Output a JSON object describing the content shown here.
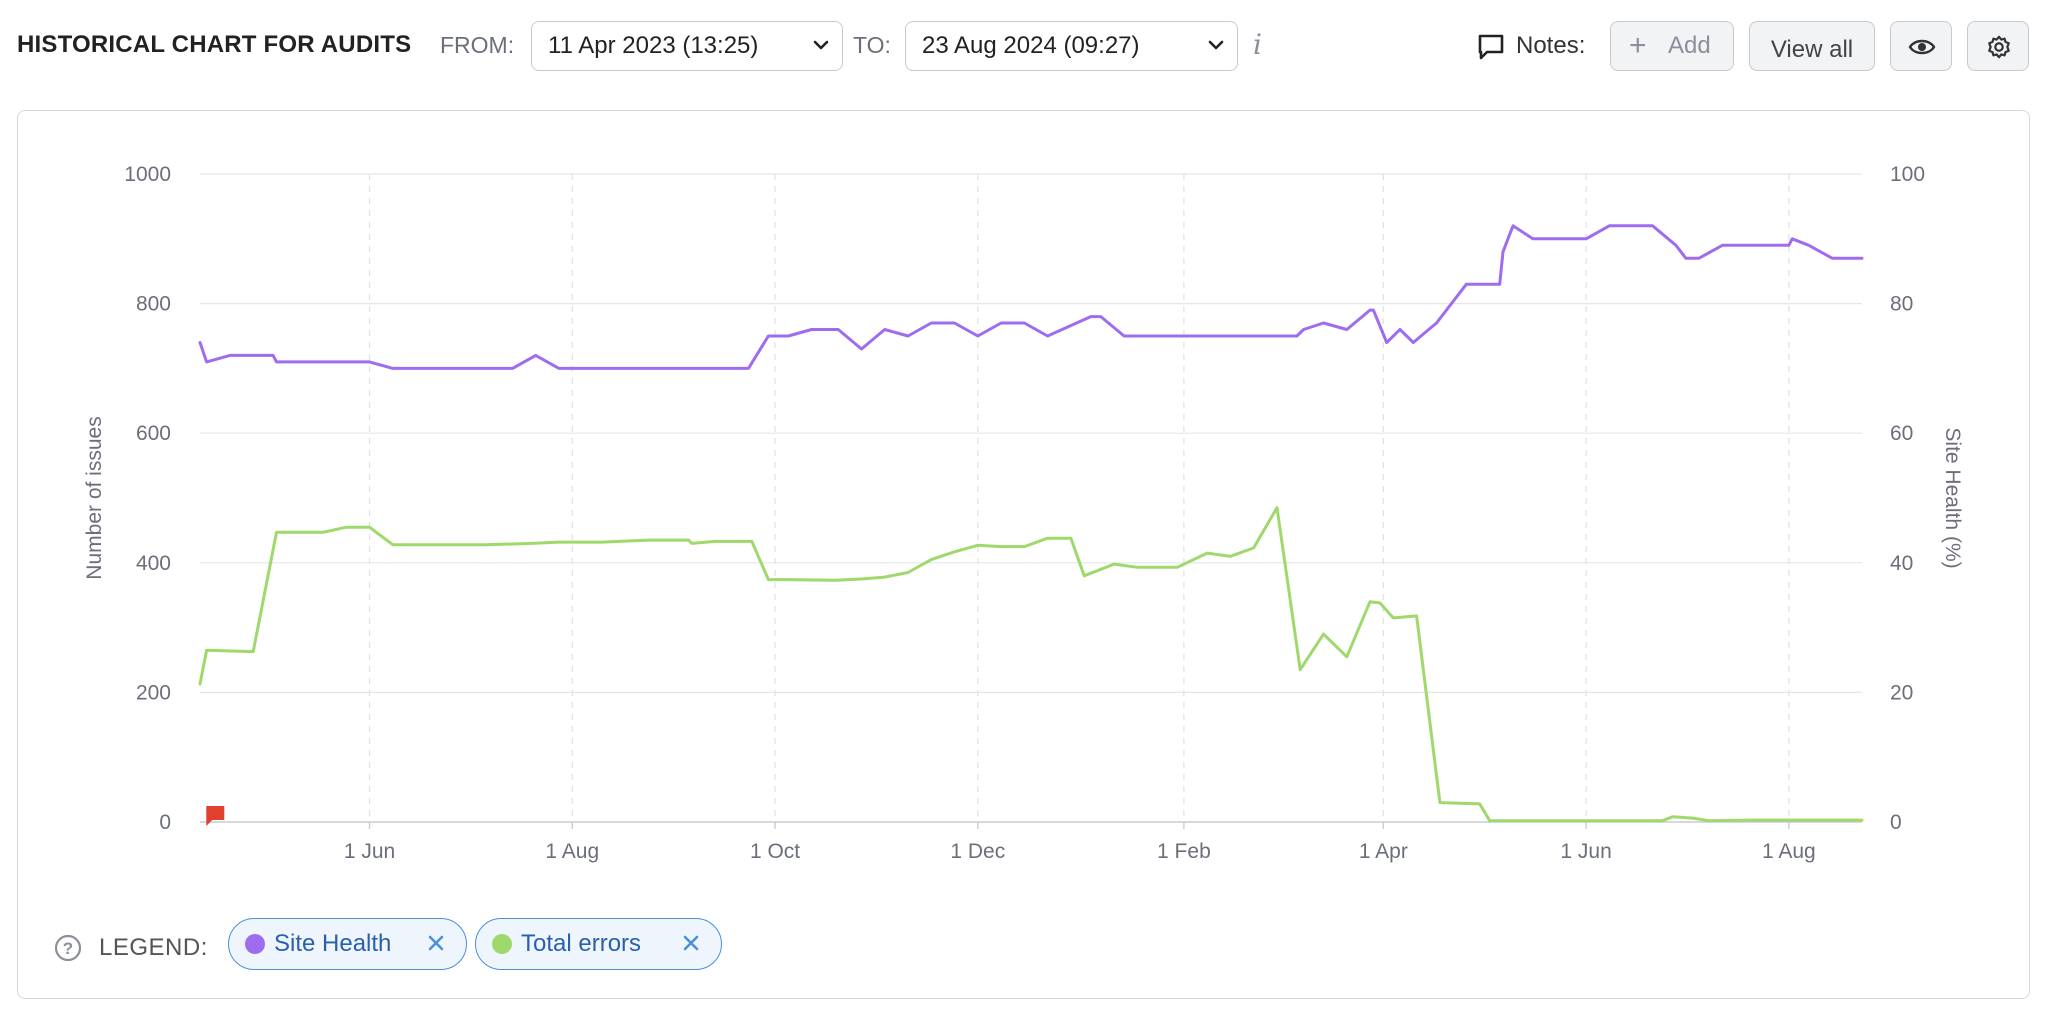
{
  "toolbar": {
    "title": "HISTORICAL CHART FOR AUDITS",
    "from_label": "FROM:",
    "from_value": "11 Apr 2023 (13:25)",
    "to_label": "TO:",
    "to_value": "23 Aug 2024 (09:27)",
    "info_glyph": "i",
    "notes_label": "Notes:",
    "add_label": "Add",
    "view_all_label": "View all",
    "icons": [
      "chevron-down-icon",
      "info-icon",
      "comment-icon",
      "plus-icon",
      "eye-icon",
      "gear-icon"
    ]
  },
  "legend": {
    "label": "LEGEND:",
    "items": [
      {
        "name": "Site Health",
        "color": "#9f6cf0"
      },
      {
        "name": "Total errors",
        "color": "#9fd86b"
      }
    ]
  },
  "chart_data": {
    "type": "line",
    "ylabel": "Number of issues",
    "y2label": "Site Health (%)",
    "ylim": [
      0,
      1000
    ],
    "y2lim": [
      0,
      100
    ],
    "yticks": [
      0,
      200,
      400,
      600,
      800,
      1000
    ],
    "y2ticks": [
      0,
      20,
      40,
      60,
      80,
      100
    ],
    "xlim": [
      "2023-04-11",
      "2024-08-23"
    ],
    "xticks": [
      {
        "date": "2023-06-01",
        "label": "1 Jun"
      },
      {
        "date": "2023-08-01",
        "label": "1 Aug"
      },
      {
        "date": "2023-10-01",
        "label": "1 Oct"
      },
      {
        "date": "2023-12-01",
        "label": "1 Dec"
      },
      {
        "date": "2024-02-01",
        "label": "1 Feb"
      },
      {
        "date": "2024-04-01",
        "label": "1 Apr"
      },
      {
        "date": "2024-06-01",
        "label": "1 Jun"
      },
      {
        "date": "2024-08-01",
        "label": "1 Aug"
      }
    ],
    "grid": true,
    "marker": {
      "date": "2023-04-15",
      "value": 0,
      "color": "#e0412e"
    },
    "series": [
      {
        "name": "Site Health",
        "axis": "right",
        "color": "#9f6cf0",
        "points": [
          [
            "2023-04-11",
            74
          ],
          [
            "2023-04-13",
            71
          ],
          [
            "2023-04-20",
            72
          ],
          [
            "2023-05-03",
            72
          ],
          [
            "2023-05-04",
            71
          ],
          [
            "2023-06-01",
            71
          ],
          [
            "2023-06-08",
            70
          ],
          [
            "2023-07-14",
            70
          ],
          [
            "2023-07-21",
            72
          ],
          [
            "2023-07-28",
            70
          ],
          [
            "2023-09-23",
            70
          ],
          [
            "2023-09-29",
            75
          ],
          [
            "2023-10-05",
            75
          ],
          [
            "2023-10-12",
            76
          ],
          [
            "2023-10-20",
            76
          ],
          [
            "2023-10-27",
            73
          ],
          [
            "2023-11-03",
            76
          ],
          [
            "2023-11-10",
            75
          ],
          [
            "2023-11-17",
            77
          ],
          [
            "2023-11-24",
            77
          ],
          [
            "2023-12-01",
            75
          ],
          [
            "2023-12-08",
            77
          ],
          [
            "2023-12-15",
            77
          ],
          [
            "2023-12-22",
            75
          ],
          [
            "2024-01-04",
            78
          ],
          [
            "2024-01-07",
            78
          ],
          [
            "2024-01-14",
            75
          ],
          [
            "2024-03-06",
            75
          ],
          [
            "2024-03-08",
            76
          ],
          [
            "2024-03-14",
            77
          ],
          [
            "2024-03-21",
            76
          ],
          [
            "2024-03-28",
            79
          ],
          [
            "2024-03-29",
            79
          ],
          [
            "2024-04-02",
            74
          ],
          [
            "2024-04-06",
            76
          ],
          [
            "2024-04-10",
            74
          ],
          [
            "2024-04-17",
            77
          ],
          [
            "2024-04-26",
            83
          ],
          [
            "2024-05-06",
            83
          ],
          [
            "2024-05-07",
            88
          ],
          [
            "2024-05-10",
            92
          ],
          [
            "2024-05-16",
            90
          ],
          [
            "2024-06-01",
            90
          ],
          [
            "2024-06-08",
            92
          ],
          [
            "2024-06-21",
            92
          ],
          [
            "2024-06-28",
            89
          ],
          [
            "2024-07-01",
            87
          ],
          [
            "2024-07-05",
            87
          ],
          [
            "2024-07-12",
            89
          ],
          [
            "2024-07-26",
            89
          ],
          [
            "2024-08-01",
            89
          ],
          [
            "2024-08-02",
            90
          ],
          [
            "2024-08-07",
            89
          ],
          [
            "2024-08-14",
            87
          ],
          [
            "2024-08-23",
            87
          ]
        ]
      },
      {
        "name": "Total errors",
        "axis": "left",
        "color": "#9fd86b",
        "points": [
          [
            "2023-04-11",
            213
          ],
          [
            "2023-04-13",
            265
          ],
          [
            "2023-04-27",
            263
          ],
          [
            "2023-05-04",
            447
          ],
          [
            "2023-05-18",
            447
          ],
          [
            "2023-05-25",
            455
          ],
          [
            "2023-06-01",
            455
          ],
          [
            "2023-06-08",
            428
          ],
          [
            "2023-06-22",
            428
          ],
          [
            "2023-07-06",
            428
          ],
          [
            "2023-07-20",
            430
          ],
          [
            "2023-07-28",
            432
          ],
          [
            "2023-08-10",
            432
          ],
          [
            "2023-08-24",
            435
          ],
          [
            "2023-09-05",
            435
          ],
          [
            "2023-09-06",
            430
          ],
          [
            "2023-09-13",
            433
          ],
          [
            "2023-09-24",
            433
          ],
          [
            "2023-09-29",
            374
          ],
          [
            "2023-10-05",
            374
          ],
          [
            "2023-10-19",
            373
          ],
          [
            "2023-10-27",
            375
          ],
          [
            "2023-11-03",
            378
          ],
          [
            "2023-11-10",
            385
          ],
          [
            "2023-11-17",
            405
          ],
          [
            "2023-11-24",
            417
          ],
          [
            "2023-12-01",
            427
          ],
          [
            "2023-12-08",
            425
          ],
          [
            "2023-12-15",
            425
          ],
          [
            "2023-12-22",
            438
          ],
          [
            "2023-12-29",
            438
          ],
          [
            "2024-01-02",
            380
          ],
          [
            "2024-01-11",
            398
          ],
          [
            "2024-01-18",
            393
          ],
          [
            "2024-01-30",
            393
          ],
          [
            "2024-02-08",
            415
          ],
          [
            "2024-02-15",
            410
          ],
          [
            "2024-02-22",
            423
          ],
          [
            "2024-02-29",
            485
          ],
          [
            "2024-03-07",
            235
          ],
          [
            "2024-03-14",
            290
          ],
          [
            "2024-03-21",
            255
          ],
          [
            "2024-03-28",
            340
          ],
          [
            "2024-03-31",
            338
          ],
          [
            "2024-04-04",
            315
          ],
          [
            "2024-04-11",
            318
          ],
          [
            "2024-04-18",
            30
          ],
          [
            "2024-04-30",
            28
          ],
          [
            "2024-05-03",
            2
          ],
          [
            "2024-06-24",
            2
          ],
          [
            "2024-06-27",
            8
          ],
          [
            "2024-07-03",
            6
          ],
          [
            "2024-07-08",
            2
          ],
          [
            "2024-07-20",
            3
          ],
          [
            "2024-08-23",
            3
          ]
        ]
      }
    ]
  }
}
